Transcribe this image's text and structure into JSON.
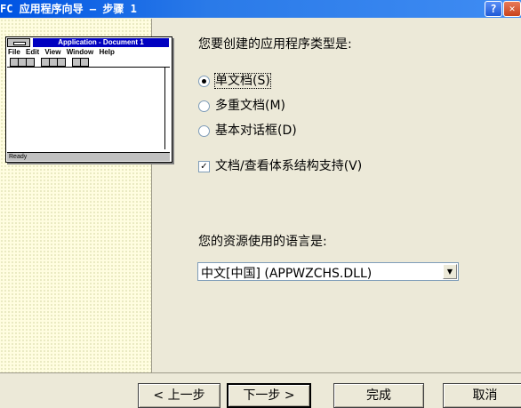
{
  "window": {
    "title": "FC 应用程序向导 – 步骤 1",
    "help_glyph": "?",
    "close_glyph": "✕"
  },
  "preview": {
    "title": "Application - Document 1",
    "menu": [
      "File",
      "Edit",
      "View",
      "Window",
      "Help"
    ],
    "status": "Ready"
  },
  "app_type": {
    "heading": "您要创建的应用程序类型是:",
    "options": [
      {
        "label": "单文档(S)",
        "selected": true
      },
      {
        "label": "多重文档(M)",
        "selected": false
      },
      {
        "label": "基本对话框(D)",
        "selected": false
      }
    ]
  },
  "doc_view": {
    "label": "文档/查看体系结构支持(V)",
    "checked": true,
    "check_glyph": "✓"
  },
  "language": {
    "label": "您的资源使用的语言是:",
    "value": "中文[中国] (APPWZCHS.DLL)",
    "arrow_glyph": "▼"
  },
  "buttons": {
    "back": "< 上一步",
    "next": "下一步 >",
    "finish": "完成",
    "cancel": "取消"
  }
}
